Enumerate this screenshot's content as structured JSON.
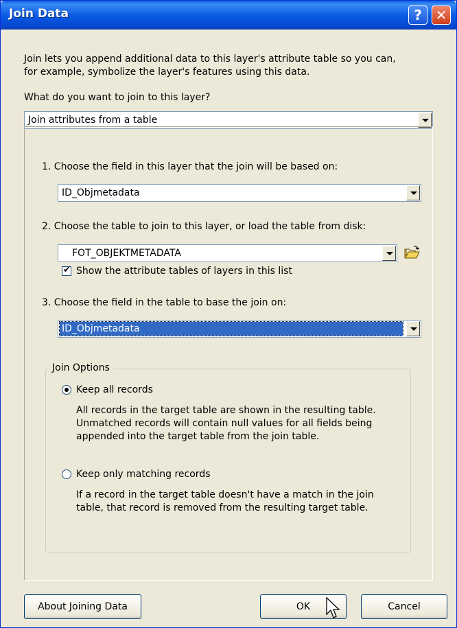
{
  "window": {
    "title": "Join Data"
  },
  "intro_text": [
    "Join lets you append additional data to this layer's attribute table so you can,",
    "for example, symbolize the layer's features using this data."
  ],
  "question": "What do you want to join to this layer?",
  "join_type": {
    "value": "Join attributes from a table"
  },
  "step1": {
    "label": "1.  Choose the field in this layer that the join will be based on:",
    "value": "ID_Objmetadata"
  },
  "step2": {
    "label": "2.  Choose the table to join to this layer, or load the table from disk:",
    "value": "FOT_OBJEKTMETADATA",
    "show_layers_label": "Show the attribute tables of layers in this list"
  },
  "step3": {
    "label": "3.  Choose the field in the table to base the join on:",
    "value": "ID_Objmetadata"
  },
  "join_options": {
    "title": "Join Options",
    "keep_all": {
      "label": "Keep all records",
      "desc": [
        "All records in the target table are shown in the resulting table.",
        "Unmatched records will contain null values for all fields being",
        "appended into the target table from the join table."
      ]
    },
    "keep_matching": {
      "label": "Keep only matching records",
      "desc": [
        "If a record in the target table doesn't have a match in the join",
        "table, that record is removed from the resulting target table."
      ]
    }
  },
  "buttons": {
    "about": "About Joining Data",
    "ok": "OK",
    "cancel": "Cancel"
  },
  "icons": {
    "help": "help-icon",
    "close": "close-icon",
    "folder": "open-folder-icon",
    "cursor": "mouse-pointer-icon"
  }
}
